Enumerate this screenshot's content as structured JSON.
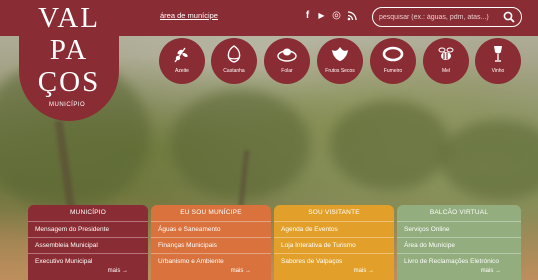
{
  "logo": {
    "line1": "VAL",
    "line2": "PA",
    "line3": "ÇOS",
    "subtitle": "MUNICÍPIO"
  },
  "topbar": {
    "area_link": "área de munícipe",
    "social": [
      {
        "name": "facebook-icon",
        "glyph": "f"
      },
      {
        "name": "youtube-icon",
        "glyph": "▶"
      },
      {
        "name": "instagram-icon",
        "glyph": "◎"
      },
      {
        "name": "rss-icon",
        "glyph": "⟟"
      }
    ],
    "search_placeholder": "pesquisar (ex.: águas, pdm, atas...)"
  },
  "products": [
    {
      "label": "Azeite",
      "icon": "olive-branch-icon"
    },
    {
      "label": "Castanha",
      "icon": "chestnut-icon"
    },
    {
      "label": "Folar",
      "icon": "folar-bread-icon"
    },
    {
      "label": "Frutos Secos",
      "icon": "dried-fruits-icon"
    },
    {
      "label": "Fumeiro",
      "icon": "sausage-icon"
    },
    {
      "label": "Mel",
      "icon": "bee-icon"
    },
    {
      "label": "Vinho",
      "icon": "wine-glass-icon"
    }
  ],
  "panels": [
    {
      "title": "MUNICÍPIO",
      "color": "#8a2c33",
      "items": [
        "Mensagem do Presidente",
        "Assembleia Municipal",
        "Executivo Municipal"
      ],
      "more": "mais →"
    },
    {
      "title": "EU SOU MUNÍCIPE",
      "color": "#d9723d",
      "items": [
        "Águas e Saneamento",
        "Finanças Municipais",
        "Urbanismo e Ambiente"
      ],
      "more": "mais →"
    },
    {
      "title": "SOU VISITANTE",
      "color": "#e2a02a",
      "items": [
        "Agenda de Eventos",
        "Loja Interativa de Turismo",
        "Sabores de Valpaços"
      ],
      "more": "mais →"
    },
    {
      "title": "BALCÃO VIRTUAL",
      "color": "#93ad7e",
      "items": [
        "Serviços Online",
        "Área do Munícipe",
        "Livro de Reclamações Eletrónico"
      ],
      "more": "mais →"
    }
  ],
  "colors": {
    "brand": "#8a2c33",
    "white": "#ffffff"
  }
}
